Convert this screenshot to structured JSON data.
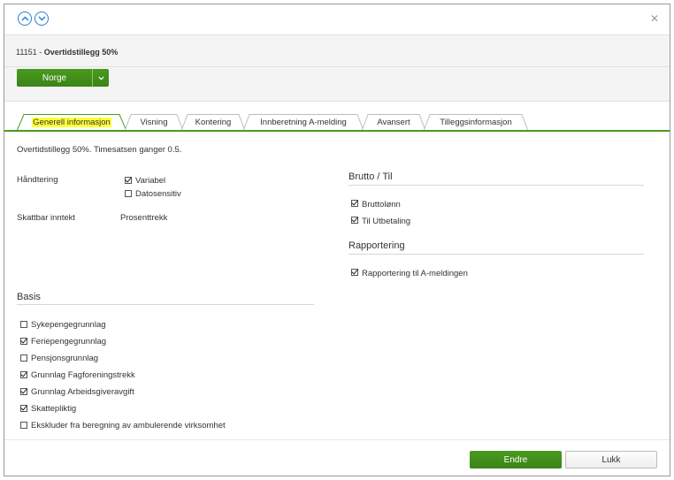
{
  "header": {
    "code": "11151",
    "separator": " - ",
    "name": "Overtidstillegg 50%",
    "close_icon": "close-icon",
    "nav_up_icon": "chevron-up-circle-icon",
    "nav_down_icon": "chevron-down-circle-icon",
    "country_button": "Norge"
  },
  "tabs": [
    {
      "label": "Generell informasjon",
      "active": true
    },
    {
      "label": "Visning"
    },
    {
      "label": "Kontering"
    },
    {
      "label": "Innberetning A-melding"
    },
    {
      "label": "Avansert"
    },
    {
      "label": "Tilleggsinformasjon"
    }
  ],
  "description": "Overtidstillegg 50%. Timesatsen ganger 0.5.",
  "handtering": {
    "label": "Håndtering",
    "options": [
      {
        "label": "Variabel",
        "checked": true
      },
      {
        "label": "Datosensitiv",
        "checked": false
      }
    ]
  },
  "skattbar": {
    "label": "Skattbar inntekt",
    "value": "Prosenttrekk"
  },
  "basis": {
    "title": "Basis",
    "items": [
      {
        "label": "Sykepengegrunnlag",
        "checked": false
      },
      {
        "label": "Feriepengegrunnlag",
        "checked": true
      },
      {
        "label": "Pensjonsgrunnlag",
        "checked": false
      },
      {
        "label": "Grunnlag Fagforeningstrekk",
        "checked": true
      },
      {
        "label": "Grunnlag Arbeidsgiveravgift",
        "checked": true
      },
      {
        "label": "Skattepliktig",
        "checked": true
      },
      {
        "label": "Ekskluder fra beregning av ambulerende virksomhet",
        "checked": false
      }
    ]
  },
  "brutto": {
    "title": "Brutto / Til",
    "items": [
      {
        "label": "Bruttolønn",
        "checked": true
      },
      {
        "label": "Til Utbetaling",
        "checked": true
      }
    ]
  },
  "rapportering": {
    "title": "Rapportering",
    "items": [
      {
        "label": "Rapportering til A-meldingen",
        "checked": true
      }
    ]
  },
  "footer": {
    "primary": "Endre",
    "secondary": "Lukk"
  },
  "colors": {
    "accent": "#4a9a1f",
    "highlight": "#ffff3a",
    "link": "#2a7fd4"
  }
}
